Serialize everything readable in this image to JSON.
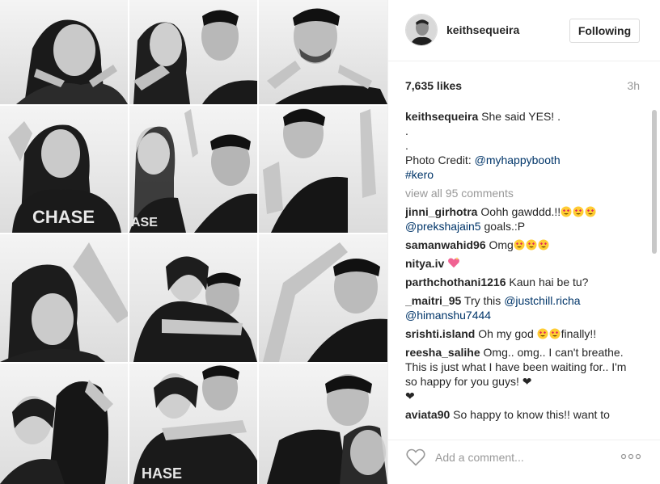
{
  "post": {
    "photo_alt": "Black and white photo booth collage of a couple"
  },
  "header": {
    "username": "keithsequeira",
    "follow_label": "Following"
  },
  "stats": {
    "likes": "7,635 likes",
    "time": "3h"
  },
  "caption": {
    "username": "keithsequeira",
    "text": " She said YES! .",
    "dot1": ".",
    "dot2": ".",
    "credit_prefix": "Photo Credit: ",
    "credit_link": "@myhappybooth",
    "hashtag": "#kero"
  },
  "view_all": "view all 95 comments",
  "comments": [
    {
      "username": "jinni_girhotra",
      "text": " Oohh gawddd.!!",
      "emoji": "heart-eyes-x3",
      "mention": "@prekshajain5",
      "after": " goals.:P"
    },
    {
      "username": "samanwahid96",
      "text": " Omg",
      "emoji": "heart-eyes-x3"
    },
    {
      "username": "nitya.iv",
      "text": " ",
      "emoji": "sparkling-heart"
    },
    {
      "username": "parthchothani1216",
      "text": " Kaun hai be tu?"
    },
    {
      "username": "_maitri_95",
      "text": " Try this ",
      "mention": "@justchill.richa",
      "mention2": "@himanshu7444"
    },
    {
      "username": "srishti.island",
      "text": " Oh my god ",
      "emoji": "heart-eyes-x2",
      "after": "finally!!"
    },
    {
      "username": "reesha_salihe",
      "text": " Omg.. omg.. I can't breathe. This is just what I have been waiting for.. I'm so happy for you guys! ❤",
      "extra": "❤"
    },
    {
      "username": "aviata90",
      "text": " So happy to know this!! want to"
    }
  ],
  "footer": {
    "add_comment_placeholder": "Add a comment...",
    "more_label": "more options"
  },
  "colors": {
    "text": "#262626",
    "link": "#003569",
    "muted": "#999999",
    "border": "#efefef",
    "emoji_face": "#ffcc33",
    "emoji_heart": "#e0245e"
  }
}
